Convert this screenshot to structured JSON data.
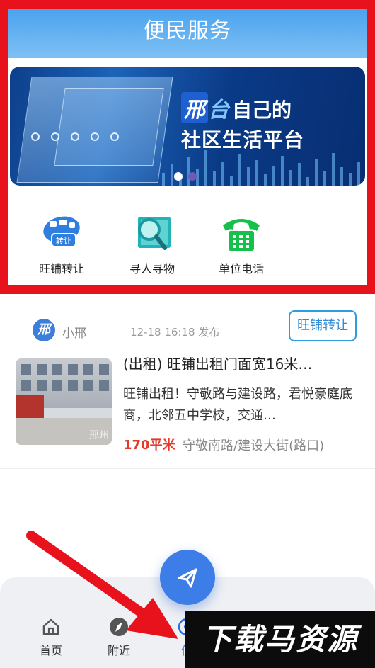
{
  "service": {
    "title": "便民服务",
    "banner": {
      "brand_part1": "邢",
      "brand_part2": "台",
      "line1_rest": "自己的",
      "line2": "社区生活平台",
      "slides_total": 2,
      "active_slide": 1
    },
    "quick_links": [
      {
        "label": "旺铺转让",
        "icon": "shop-transfer-icon",
        "badge": "转让"
      },
      {
        "label": "寻人寻物",
        "icon": "magnifier-search-icon"
      },
      {
        "label": "单位电话",
        "icon": "telephone-icon"
      }
    ]
  },
  "post": {
    "avatar_text": "邢",
    "author": "小邢",
    "time": "12-18 16:18 发布",
    "tag": "旺铺转让",
    "title": "(出租) 旺铺出租门面宽16米…",
    "description": "旺铺出租！守敬路与建设路，君悦豪庭底商，北邻五中学校，交通…",
    "area": "170平米",
    "location": "守敬南路/建设大街(路口)",
    "thumb_watermark": "邢州"
  },
  "nav": {
    "items": [
      {
        "label": "首页",
        "icon": "home-icon"
      },
      {
        "label": "附近",
        "icon": "compass-icon"
      },
      {
        "label": "便",
        "icon": "service-icon",
        "active": true
      }
    ]
  },
  "fab": {
    "icon": "send-plane-icon"
  },
  "watermark": {
    "text": "下载马资源"
  },
  "colors": {
    "highlight": "#e8121c",
    "header": "#4aa3ee",
    "accent": "#2d6de0",
    "price": "#e5392c"
  }
}
